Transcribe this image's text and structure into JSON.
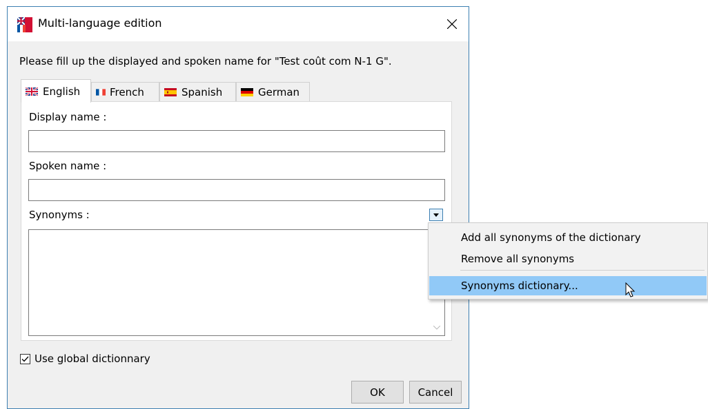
{
  "window": {
    "title": "Multi-language edition",
    "close_glyph": "✕"
  },
  "instruction": "Please fill up the displayed and spoken name for \"Test coût com N-1 G\".",
  "tabs": [
    {
      "label": "English",
      "flag": "uk-flag-icon",
      "active": true
    },
    {
      "label": "French",
      "flag": "france-flag-icon",
      "active": false
    },
    {
      "label": "Spanish",
      "flag": "spain-flag-icon",
      "active": false
    },
    {
      "label": "German",
      "flag": "germany-flag-icon",
      "active": false
    }
  ],
  "form": {
    "display_name_label": "Display name :",
    "display_name_value": "",
    "spoken_name_label": "Spoken name :",
    "spoken_name_value": "",
    "synonyms_label": "Synonyms :",
    "synonyms_value": ""
  },
  "global_dictionary": {
    "label": "Use global dictionnary",
    "checked": true
  },
  "buttons": {
    "ok": "OK",
    "cancel": "Cancel"
  },
  "context_menu": {
    "items": [
      {
        "label": "Add all synonyms of the dictionary",
        "highlighted": false
      },
      {
        "label": "Remove all synonyms",
        "highlighted": false
      },
      {
        "label": "Synonyms dictionary...",
        "highlighted": true
      }
    ]
  },
  "colors": {
    "accent_border": "#3c7fb1",
    "menu_highlight": "#91c9f7",
    "dialog_bg": "#f0f0f0"
  }
}
